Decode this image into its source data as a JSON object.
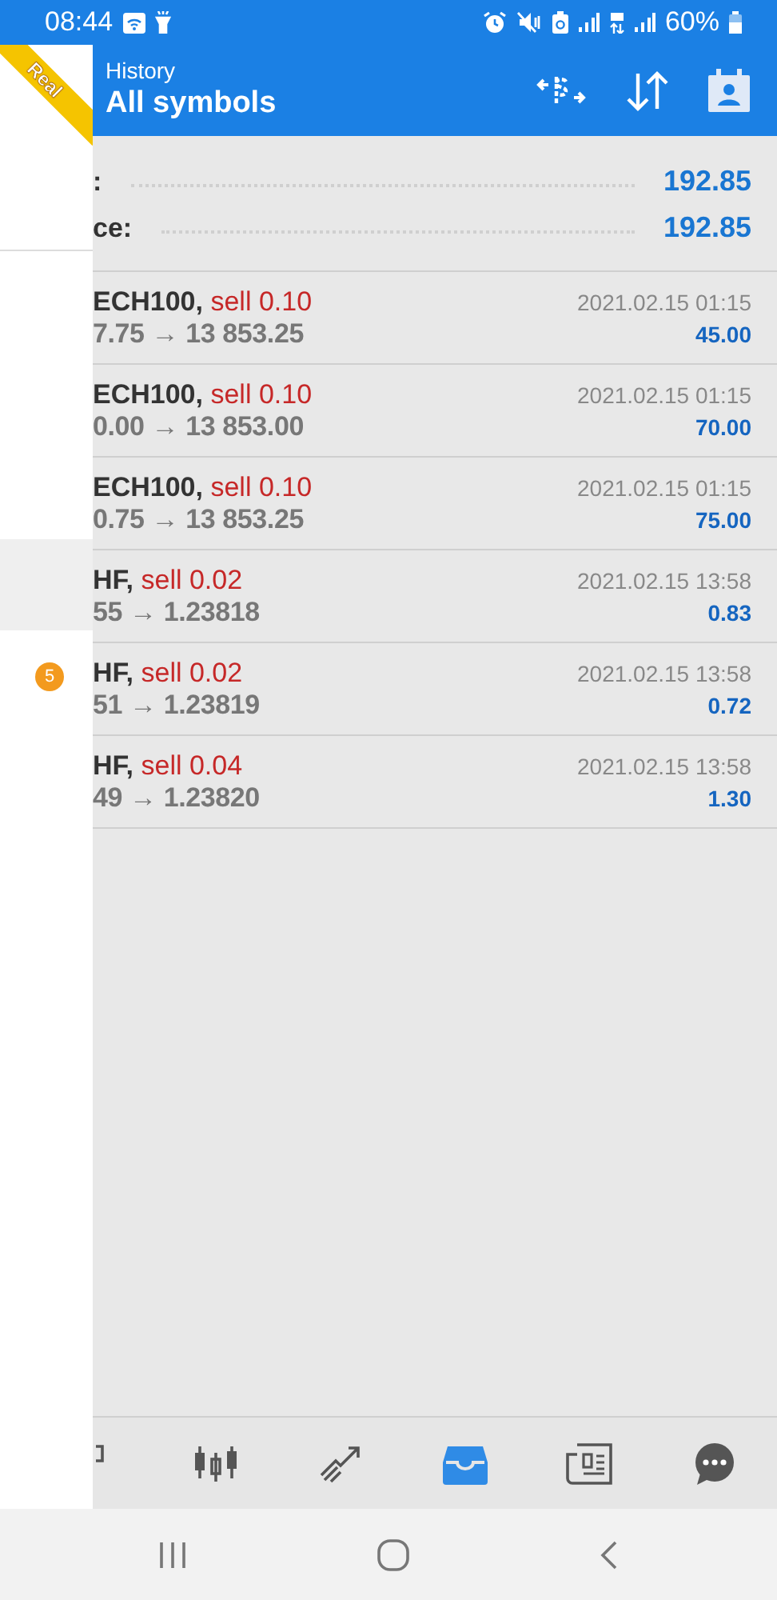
{
  "status_bar": {
    "time": "08:44",
    "battery": "60%"
  },
  "header": {
    "subtitle": "History",
    "title": "All symbols"
  },
  "drawer": {
    "ribbon": "Real",
    "items": [
      {
        "selected": true
      },
      {
        "selected": false,
        "badge": "5"
      }
    ]
  },
  "summary": [
    {
      "label": ":",
      "value": "192.85"
    },
    {
      "label": "ce:",
      "value": "192.85"
    }
  ],
  "trades": [
    {
      "symbol": "ECH100,",
      "side": "sell 0.10",
      "prices": "7.75 → 13 853.25",
      "time": "2021.02.15 01:15",
      "profit": "45.00"
    },
    {
      "symbol": "ECH100,",
      "side": "sell 0.10",
      "prices": "0.00 → 13 853.00",
      "time": "2021.02.15 01:15",
      "profit": "70.00"
    },
    {
      "symbol": "ECH100,",
      "side": "sell 0.10",
      "prices": "0.75 → 13 853.25",
      "time": "2021.02.15 01:15",
      "profit": "75.00"
    },
    {
      "symbol": "HF,",
      "side": "sell 0.02",
      "prices": "55 → 1.23818",
      "time": "2021.02.15 13:58",
      "profit": "0.83"
    },
    {
      "symbol": "HF,",
      "side": "sell 0.02",
      "prices": "51 → 1.23819",
      "time": "2021.02.15 13:58",
      "profit": "0.72"
    },
    {
      "symbol": "HF,",
      "side": "sell 0.04",
      "prices": "49 → 1.23820",
      "time": "2021.02.15 13:58",
      "profit": "1.30"
    }
  ],
  "bottom_nav": [
    {
      "kind": "partial",
      "selected": false
    },
    {
      "kind": "quotes",
      "selected": false
    },
    {
      "kind": "chart",
      "selected": false
    },
    {
      "kind": "history",
      "selected": true
    },
    {
      "kind": "news",
      "selected": false
    },
    {
      "kind": "chat",
      "selected": false
    }
  ]
}
